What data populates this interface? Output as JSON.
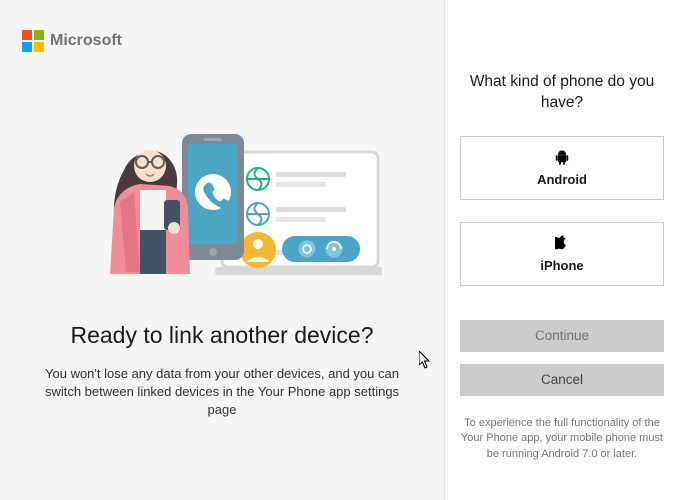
{
  "brand": {
    "name": "Microsoft"
  },
  "left": {
    "title": "Ready to link another device?",
    "subtitle": "You won't lose any data from your other devices, and you can switch between linked devices in the Your Phone app settings page"
  },
  "right": {
    "title": "What kind of phone do you have?",
    "options": [
      {
        "label": "Android",
        "icon": "android-icon"
      },
      {
        "label": "iPhone",
        "icon": "apple-icon"
      }
    ],
    "buttons": {
      "continue": "Continue",
      "cancel": "Cancel"
    },
    "footnote": "To experience the full functionality of the Your Phone app, your mobile phone must be running Android 7.0 or later."
  }
}
